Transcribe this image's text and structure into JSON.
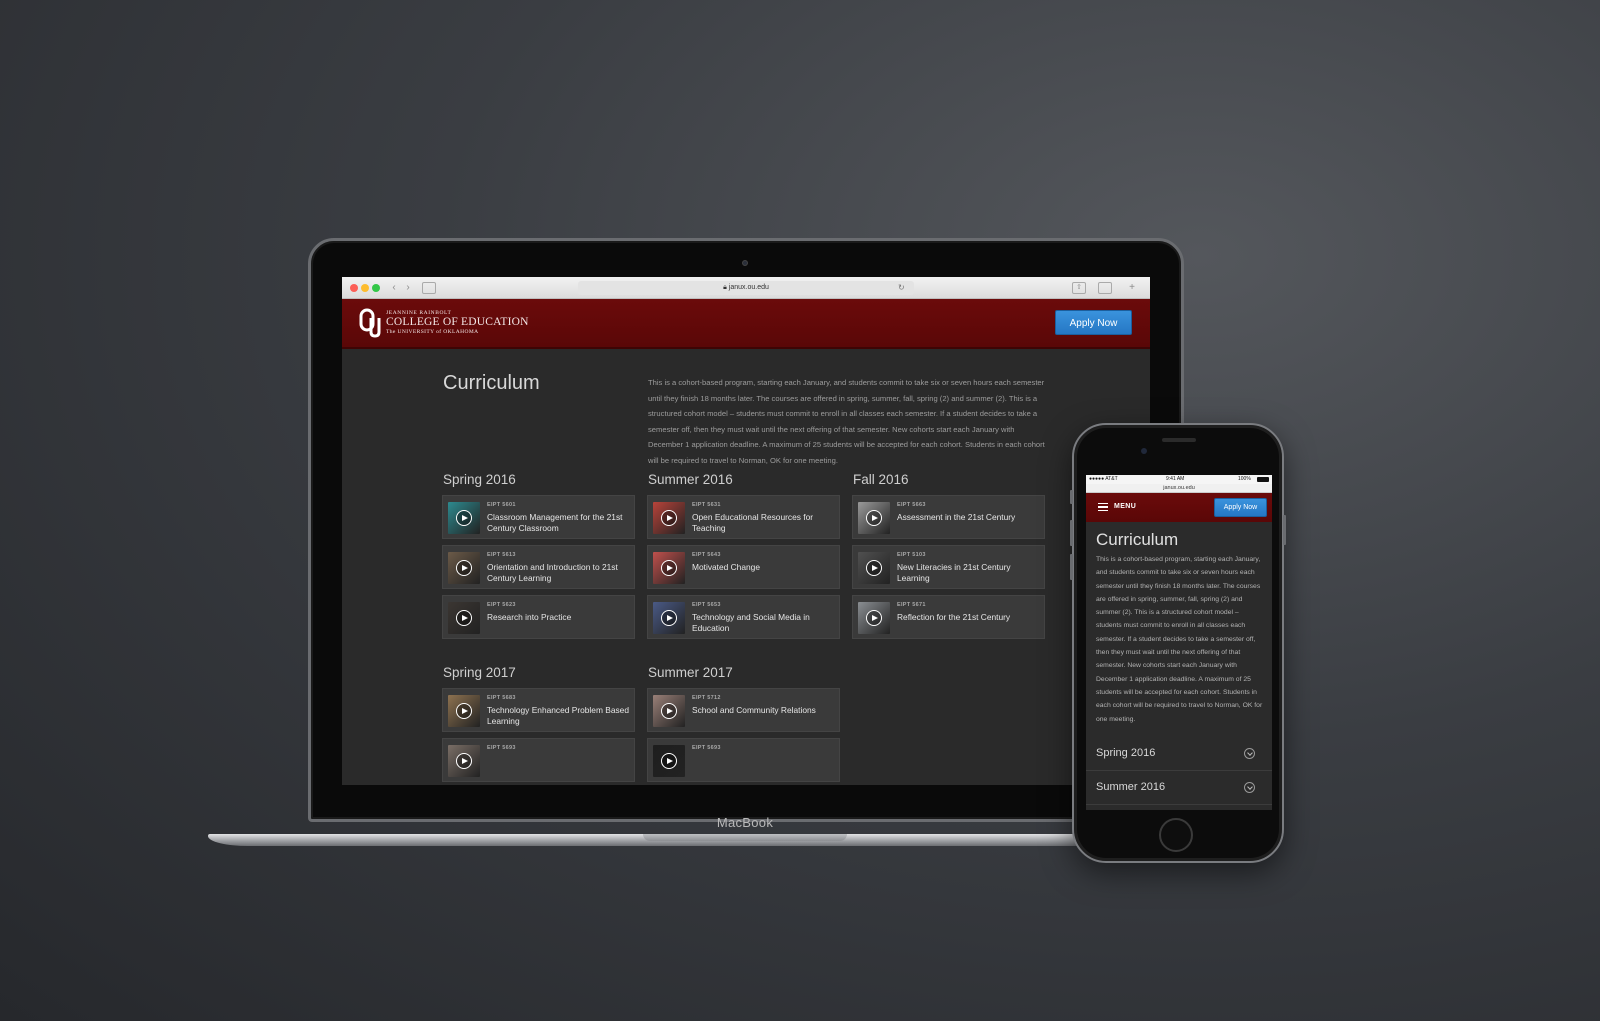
{
  "device_label": "MacBook",
  "browser": {
    "url": "janux.ou.edu"
  },
  "site": {
    "logo": {
      "line1": "JEANNINE RAINBOLT",
      "line2": "COLLEGE OF EDUCATION",
      "line3": "The UNIVERSITY of OKLAHOMA"
    },
    "apply_label": "Apply Now"
  },
  "desktop": {
    "title": "Curriculum",
    "intro": "This is a cohort-based program, starting each January, and students commit to take six or seven hours each semester until they finish 18 months later. The courses are offered in spring, summer, fall, spring (2) and summer (2). This is a structured cohort model – students must commit to enroll in all classes each semester. If a student decides to take a semester off, then they must wait until the next offering of that semester. New cohorts start each January with December 1 application deadline. A maximum of 25 students will be accepted for each cohort. Students in each cohort will be required to travel to Norman, OK for one meeting.",
    "semesters": [
      {
        "name": "Spring 2016",
        "courses": [
          {
            "code": "EIPT 5601",
            "name": "Classroom Management for the 21st Century Classroom",
            "thumb": "#2d8a8f"
          },
          {
            "code": "EIPT 5613",
            "name": "Orientation and Introduction to 21st Century Learning",
            "thumb": "#6b5a48"
          },
          {
            "code": "EIPT 5623",
            "name": "Research into Practice",
            "thumb": "#3b3632"
          }
        ]
      },
      {
        "name": "Summer 2016",
        "courses": [
          {
            "code": "EIPT 5631",
            "name": "Open Educational Resources for Teaching",
            "thumb": "#b8433a"
          },
          {
            "code": "EIPT 5643",
            "name": "Motivated Change",
            "thumb": "#c0504c"
          },
          {
            "code": "EIPT 5653",
            "name": "Technology and Social Media in Education",
            "thumb": "#4a5a86"
          }
        ]
      },
      {
        "name": "Fall 2016",
        "courses": [
          {
            "code": "EIPT 5663",
            "name": "Assessment in the 21st Century",
            "thumb": "#9a9a9a"
          },
          {
            "code": "EIPT 5103",
            "name": "New Literacies in 21st Century Learning",
            "thumb": "#505050"
          },
          {
            "code": "EIPT 5671",
            "name": "Reflection for the 21st Century",
            "thumb": "#8a8e92"
          }
        ]
      },
      {
        "name": "Spring 2017",
        "courses": [
          {
            "code": "EIPT 5683",
            "name": "Technology Enhanced Problem Based Learning",
            "thumb": "#8e7250"
          },
          {
            "code": "EIPT 5693",
            "name": "",
            "thumb": "#7a6e66"
          }
        ]
      },
      {
        "name": "Summer 2017",
        "courses": [
          {
            "code": "EIPT 5712",
            "name": "School and Community Relations",
            "thumb": "#9a8078"
          },
          {
            "code": "EIPT 5693",
            "name": "",
            "thumb": "#1e1e1e"
          }
        ]
      }
    ]
  },
  "mobile": {
    "status": {
      "carrier": "●●●●● AT&T",
      "time": "9:41 AM",
      "battery": "100%"
    },
    "url": "janux.ou.edu",
    "menu_label": "MENU",
    "apply_label": "Apply Now",
    "title": "Curriculum",
    "intro": "This is a cohort-based program, starting each January, and students commit to take six or seven hours each semester until they finish 18 months later. The courses are offered in spring, summer, fall, spring (2) and summer (2). This is a structured cohort model – students must commit to enroll in all classes each semester. If a student decides to take a semester off, then they must wait until the next offering of that semester. New cohorts start each January with December 1 application deadline. A maximum of 25 students will be accepted for each cohort. Students in each cohort will be required to travel to Norman, OK for one meeting.",
    "accordion": [
      "Spring 2016",
      "Summer 2016"
    ]
  }
}
